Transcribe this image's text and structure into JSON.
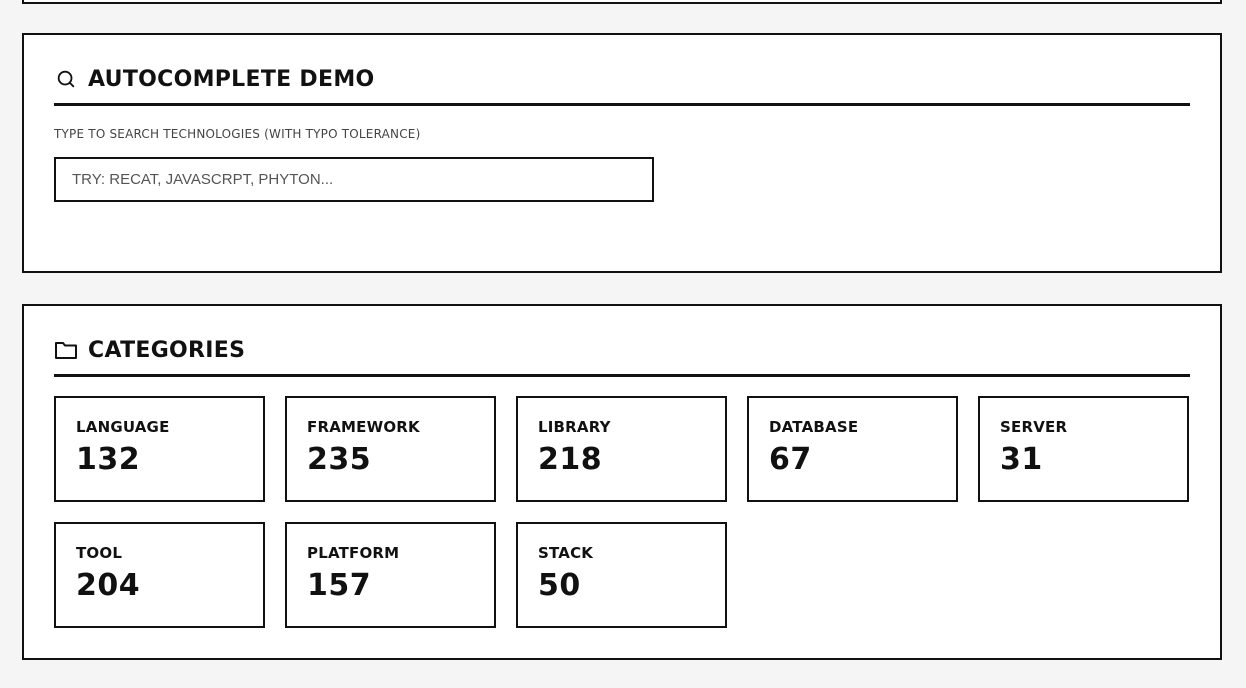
{
  "autocomplete": {
    "title": "AUTOCOMPLETE DEMO",
    "icon": "search-icon",
    "label": "TYPE TO SEARCH TECHNOLOGIES (WITH TYPO TOLERANCE)",
    "input_value": "",
    "placeholder": "TRY: RECAT, JAVASCRPT, PHYTON..."
  },
  "categories": {
    "title": "CATEGORIES",
    "icon": "folder-icon",
    "items": [
      {
        "name": "LANGUAGE",
        "count": "132"
      },
      {
        "name": "FRAMEWORK",
        "count": "235"
      },
      {
        "name": "LIBRARY",
        "count": "218"
      },
      {
        "name": "DATABASE",
        "count": "67"
      },
      {
        "name": "SERVER",
        "count": "31"
      },
      {
        "name": "TOOL",
        "count": "204"
      },
      {
        "name": "PLATFORM",
        "count": "157"
      },
      {
        "name": "STACK",
        "count": "50"
      }
    ]
  },
  "colors": {
    "border": "#111111",
    "background": "#f5f5f5",
    "panel": "#ffffff"
  }
}
